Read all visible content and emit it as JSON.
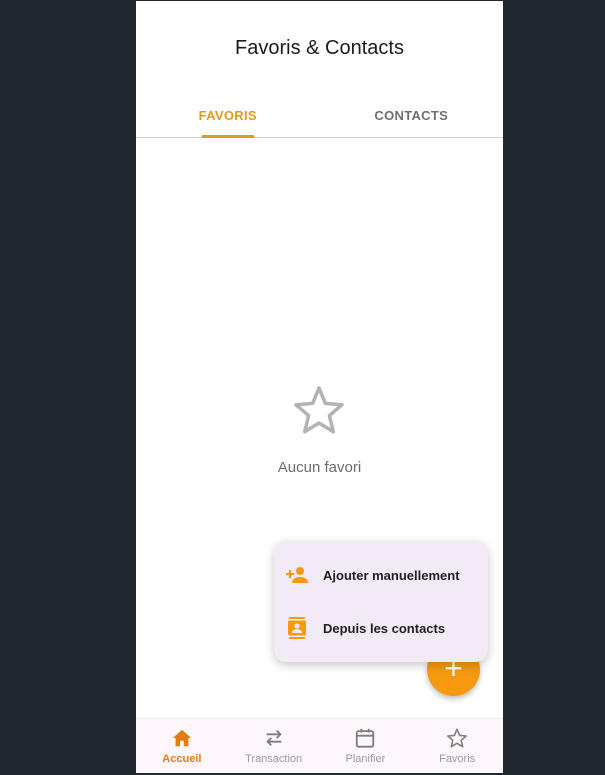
{
  "header": {
    "title": "Favoris & Contacts"
  },
  "tabs": [
    {
      "label": "FAVORIS",
      "active": true
    },
    {
      "label": "CONTACTS",
      "active": false
    }
  ],
  "empty_state": {
    "icon": "star-outline-icon",
    "message": "Aucun favori"
  },
  "fab": {
    "icon": "plus-icon",
    "glyph": "+"
  },
  "fab_menu": {
    "items": [
      {
        "icon": "person-add-icon",
        "label": "Ajouter manuellement"
      },
      {
        "icon": "contacts-icon",
        "label": "Depuis les contacts"
      }
    ]
  },
  "bottom_nav": {
    "items": [
      {
        "icon": "home-icon",
        "label": "Accueil",
        "active": true
      },
      {
        "icon": "swap-arrows-icon",
        "label": "Transaction",
        "active": false
      },
      {
        "icon": "calendar-icon",
        "label": "Planifier",
        "active": false
      },
      {
        "icon": "star-icon",
        "label": "Favoris",
        "active": false
      }
    ]
  },
  "colors": {
    "accent": "#e29b17",
    "fab": "#f6990f",
    "nav_active": "#e27c14",
    "background_outer": "#1f282e",
    "menu_background": "#f2eaf5"
  }
}
